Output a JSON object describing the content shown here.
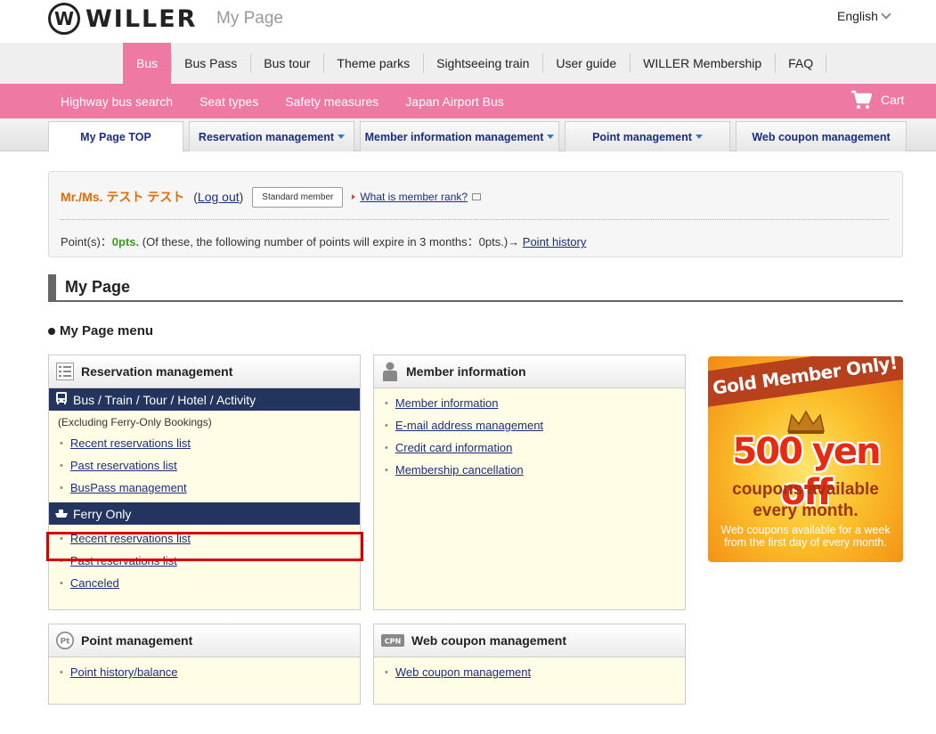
{
  "header": {
    "logo_mark": "W",
    "logo_text": "WILLER",
    "page_label": "My Page",
    "language": "English"
  },
  "main_nav": [
    "Bus",
    "Bus Pass",
    "Bus tour",
    "Theme parks",
    "Sightseeing train",
    "User guide",
    "WILLER Membership",
    "FAQ"
  ],
  "sub_nav": {
    "items": [
      "Highway bus search",
      "Seat types",
      "Safety measures",
      "Japan Airport Bus"
    ],
    "cart": "Cart"
  },
  "tabs": [
    "My Page TOP",
    "Reservation management",
    "Member information management",
    "Point management",
    "Web coupon management"
  ],
  "member": {
    "name": "Mr./Ms.  テスト テスト",
    "logout_open": "(",
    "logout": "Log out",
    "logout_close": ")",
    "rank": "Standard member",
    "rank_question": "What is member rank?",
    "points_label": "Point(s)：",
    "points_value": "0pts.",
    "expire_text": " (Of these, the following number of points will expire in 3 months：0pts.)→ ",
    "point_history": "Point history"
  },
  "section_title": "My Page",
  "menu_title": "My Page menu",
  "reservation": {
    "title": "Reservation management",
    "bus_category": "Bus / Train / Tour / Hotel / Activity",
    "bus_note": "(Excluding Ferry-Only Bookings)",
    "bus_links": [
      "Recent reservations list",
      "Past reservations list",
      "BusPass management"
    ],
    "ferry_category": "Ferry Only",
    "ferry_links": [
      "Recent reservations list",
      "Past reservations list",
      "Canceled"
    ]
  },
  "member_info": {
    "title": "Member information",
    "links": [
      "Member information",
      "E-mail address management",
      "Credit card information",
      "Membership cancellation"
    ]
  },
  "points": {
    "title": "Point management",
    "icon_text": "Pt",
    "links": [
      "Point history/balance"
    ]
  },
  "coupon": {
    "title": "Web coupon management",
    "icon_text": "CPN",
    "links": [
      "Web coupon management"
    ]
  },
  "promo": {
    "ribbon": "Gold Member Only!",
    "headline": "500 yen off",
    "line1": "coupons available",
    "line2": "every month.",
    "footer1": "Web coupons available for a week",
    "footer2": "from the first day of every month."
  },
  "colors": {
    "pink": "#ee7aa3",
    "navy": "#23355f",
    "link": "#1a2e80",
    "highlight": "#d40000"
  }
}
